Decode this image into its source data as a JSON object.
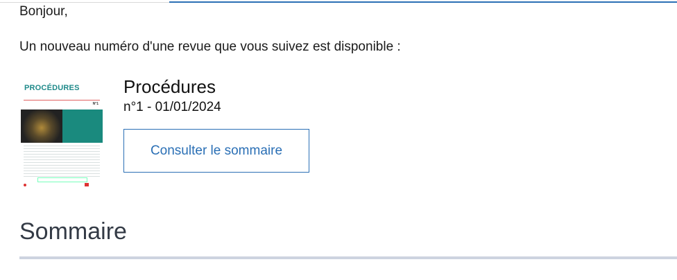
{
  "email": {
    "greeting": "Bonjour,",
    "intro": "Un nouveau numéro d'une revue que vous suivez est disponible :"
  },
  "journal": {
    "title": "Procédures",
    "issue": "n°1 - 01/01/2024",
    "cover_title": "PROCÉDURES",
    "cover_number": "N°1",
    "consult_button": "Consulter le sommaire"
  },
  "section": {
    "heading": "Sommaire"
  },
  "colors": {
    "accent": "#2a6fb5",
    "cover_teal": "#1a8a7e",
    "divider": "#cdd3e0"
  }
}
